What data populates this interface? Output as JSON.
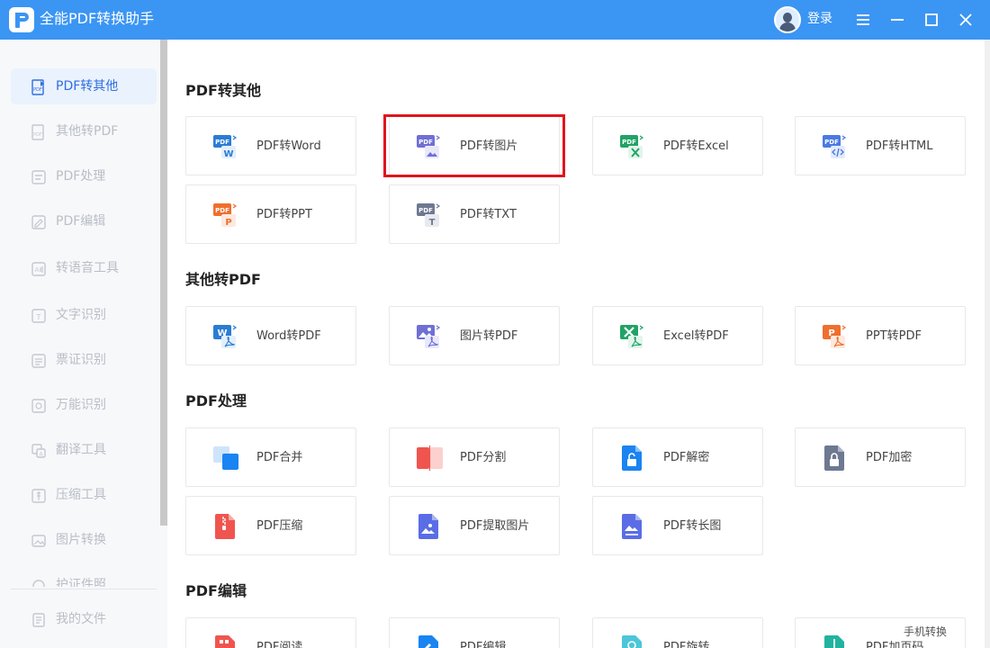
{
  "app": {
    "title": "全能PDF转换助手",
    "login_label": "登录"
  },
  "sidebar": {
    "items": [
      {
        "label": "PDF转其他"
      },
      {
        "label": "其他转PDF"
      },
      {
        "label": "PDF处理"
      },
      {
        "label": "PDF编辑"
      },
      {
        "label": "转语音工具"
      },
      {
        "label": "文字识别"
      },
      {
        "label": "票证识别"
      },
      {
        "label": "万能识别"
      },
      {
        "label": "翻译工具"
      },
      {
        "label": "压缩工具"
      },
      {
        "label": "图片转换"
      },
      {
        "label": "护证件照"
      }
    ],
    "footer": {
      "label": "我的文件"
    }
  },
  "sections": [
    {
      "title": "PDF转其他",
      "cards": [
        {
          "label": "PDF转Word"
        },
        {
          "label": "PDF转图片"
        },
        {
          "label": "PDF转Excel"
        },
        {
          "label": "PDF转HTML"
        },
        {
          "label": "PDF转PPT"
        },
        {
          "label": "PDF转TXT"
        }
      ]
    },
    {
      "title": "其他转PDF",
      "cards": [
        {
          "label": "Word转PDF"
        },
        {
          "label": "图片转PDF"
        },
        {
          "label": "Excel转PDF"
        },
        {
          "label": "PPT转PDF"
        }
      ]
    },
    {
      "title": "PDF处理",
      "cards": [
        {
          "label": "PDF合并"
        },
        {
          "label": "PDF分割"
        },
        {
          "label": "PDF解密"
        },
        {
          "label": "PDF加密"
        },
        {
          "label": "PDF压缩"
        },
        {
          "label": "PDF提取图片"
        },
        {
          "label": "PDF转长图"
        }
      ]
    },
    {
      "title": "PDF编辑",
      "cards": [
        {
          "label": "PDF阅读"
        },
        {
          "label": "PDF编辑"
        },
        {
          "label": "PDF旋转"
        },
        {
          "label": "PDF加页码"
        }
      ]
    }
  ],
  "floating": {
    "phone_convert": "手机转换"
  },
  "colors": {
    "titlebar": "#3b95f3",
    "active": "#2f6fe0",
    "highlight": "#e0151d"
  }
}
